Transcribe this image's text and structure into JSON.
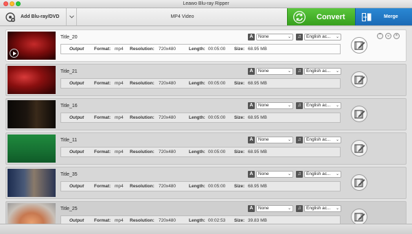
{
  "window": {
    "title": "Leawo Blu-ray Ripper"
  },
  "toolbar": {
    "add_label": "Add Blu-ray/DVD",
    "profile": "MP4 Video",
    "convert_label": "Convert",
    "merge_label": "Merge"
  },
  "labels": {
    "output": "Output",
    "format": "Format:",
    "resolution": "Resolution:",
    "length": "Length:",
    "size": "Size:"
  },
  "titles": [
    {
      "name": "Title_20",
      "format": "mp4",
      "resolution": "720x480",
      "length": "00:05:00",
      "size": "68.95 MB",
      "subtitle": "None",
      "audio": "English ac..."
    },
    {
      "name": "Title_21",
      "format": "mp4",
      "resolution": "720x480",
      "length": "00:05:00",
      "size": "68.95 MB",
      "subtitle": "None",
      "audio": "English ac..."
    },
    {
      "name": "Title_16",
      "format": "mp4",
      "resolution": "720x480",
      "length": "00:05:00",
      "size": "68.95 MB",
      "subtitle": "None",
      "audio": "English ac..."
    },
    {
      "name": "Title_11",
      "format": "mp4",
      "resolution": "720x480",
      "length": "00:05:00",
      "size": "68.95 MB",
      "subtitle": "None",
      "audio": "English ac..."
    },
    {
      "name": "Title_35",
      "format": "mp4",
      "resolution": "720x480",
      "length": "00:05:00",
      "size": "68.95 MB",
      "subtitle": "None",
      "audio": "English ac..."
    },
    {
      "name": "Title_25",
      "format": "mp4",
      "resolution": "720x480",
      "length": "00:02:53",
      "size": "39.83 MB",
      "subtitle": "None",
      "audio": "English ac..."
    }
  ],
  "icons": {
    "add": "disc-add-icon",
    "convert": "refresh-arrows-icon",
    "merge": "merge-icon",
    "subtitle": "subtitle-a-icon",
    "audio": "music-note-icon",
    "edit": "edit-film-icon",
    "play": "play-icon"
  },
  "colors": {
    "convert": "#3fae22",
    "merge": "#1f74c3"
  }
}
